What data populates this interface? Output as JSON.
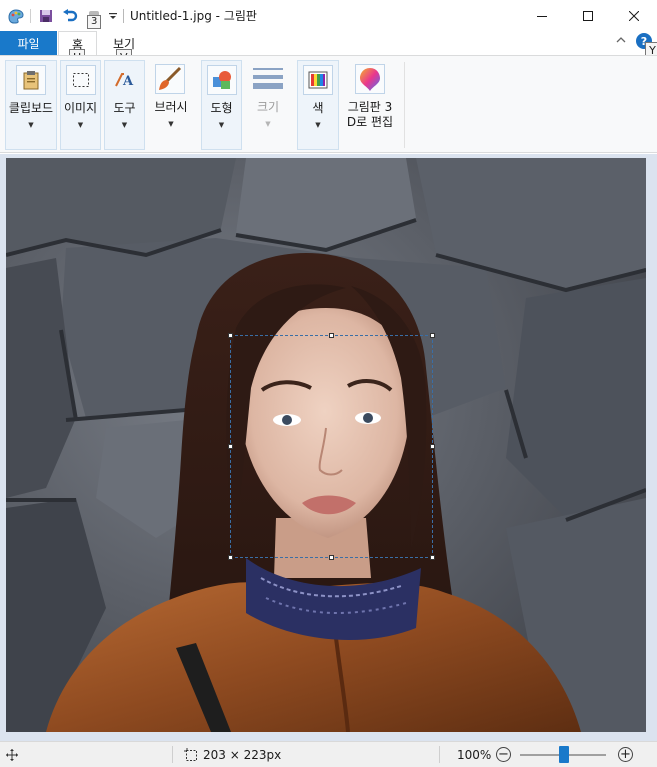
{
  "window": {
    "title": "Untitled-1.jpg - 그림판"
  },
  "quick_access": {
    "undo_keytip": "3"
  },
  "tabs": {
    "file_label": "파일",
    "home_label": "홈",
    "view_label": "보기",
    "home_keytip": "H",
    "view_keytip": "V",
    "help_keytip": "Y"
  },
  "ribbon": {
    "clipboard_label": "클립보드",
    "image_label": "이미지",
    "tools_label": "도구",
    "brushes_label": "브러시",
    "shapes_label": "도형",
    "size_label": "크기",
    "colors_label": "색",
    "paint3d_label_line1": "그림판 3",
    "paint3d_label_line2": "D로 편집"
  },
  "status": {
    "selection_size": "203 × 223px",
    "zoom_level": "100%",
    "zoom_minus": "−",
    "zoom_plus": "+"
  },
  "colors": {
    "accent": "#1979ca",
    "selected_group_bg": "#eef4fa",
    "workspace_bg": "#dbe3ef"
  },
  "icons": {
    "app": "paint-app-icon",
    "save": "save-icon",
    "undo": "undo-icon",
    "redo": "redo-icon",
    "customize": "customize-quick-access-icon",
    "minimize": "minimize-icon",
    "maximize": "maximize-icon",
    "close": "close-icon",
    "collapse_ribbon": "chevron-up-icon",
    "help": "help-icon",
    "move": "move-cursor-icon",
    "selection": "selection-size-icon"
  }
}
